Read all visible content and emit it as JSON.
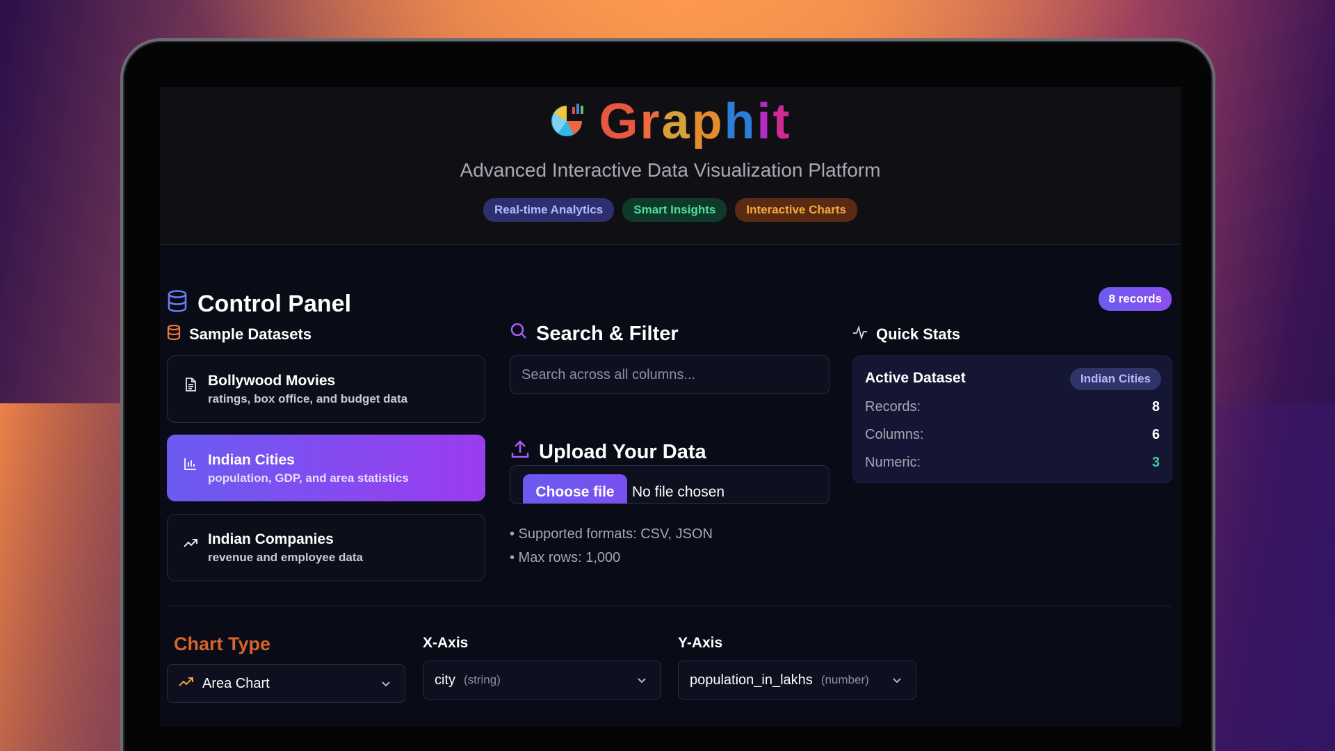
{
  "header": {
    "brand_letters": [
      "G",
      "r",
      "a",
      "p",
      "h",
      "i",
      "t"
    ],
    "subtitle": "Advanced Interactive Data Visualization Platform",
    "badges": [
      "Real-time Analytics",
      "Smart Insights",
      "Interactive Charts"
    ]
  },
  "control_panel": {
    "title": "Control Panel",
    "records_badge": "8 records"
  },
  "sample_datasets": {
    "title": "Sample Datasets",
    "items": [
      {
        "title": "Bollywood Movies",
        "desc": "ratings, box office, and budget data",
        "icon": "document-icon"
      },
      {
        "title": "Indian Cities",
        "desc": "population, GDP, and area statistics",
        "icon": "bar-chart-icon",
        "active": true
      },
      {
        "title": "Indian Companies",
        "desc": "revenue and employee data",
        "icon": "trending-up-icon"
      }
    ]
  },
  "search": {
    "title": "Search & Filter",
    "placeholder": "Search across all columns..."
  },
  "upload": {
    "title": "Upload Your Data",
    "button": "Choose file",
    "status": "No file chosen",
    "notes": [
      "• Supported formats: CSV, JSON",
      "• Max rows: 1,000"
    ]
  },
  "quick_stats": {
    "title": "Quick Stats",
    "active_dataset_label": "Active Dataset",
    "active_dataset": "Indian Cities",
    "rows": [
      {
        "label": "Records:",
        "value": "8"
      },
      {
        "label": "Columns:",
        "value": "6"
      },
      {
        "label": "Numeric:",
        "value": "3"
      }
    ],
    "numeric_color": "#3ad29f"
  },
  "controls": {
    "chart_type_label": "Chart Type",
    "chart_type_value": "Area Chart",
    "x_axis_label": "X-Axis",
    "x_axis_value": "city",
    "x_axis_type": "(string)",
    "y_axis_label": "Y-Axis",
    "y_axis_value": "population_in_lakhs",
    "y_axis_type": "(number)"
  },
  "colors": {
    "accent": "#6c5cf0",
    "accent2": "#9b3cf0",
    "chart_type_label": "#d8632e"
  }
}
